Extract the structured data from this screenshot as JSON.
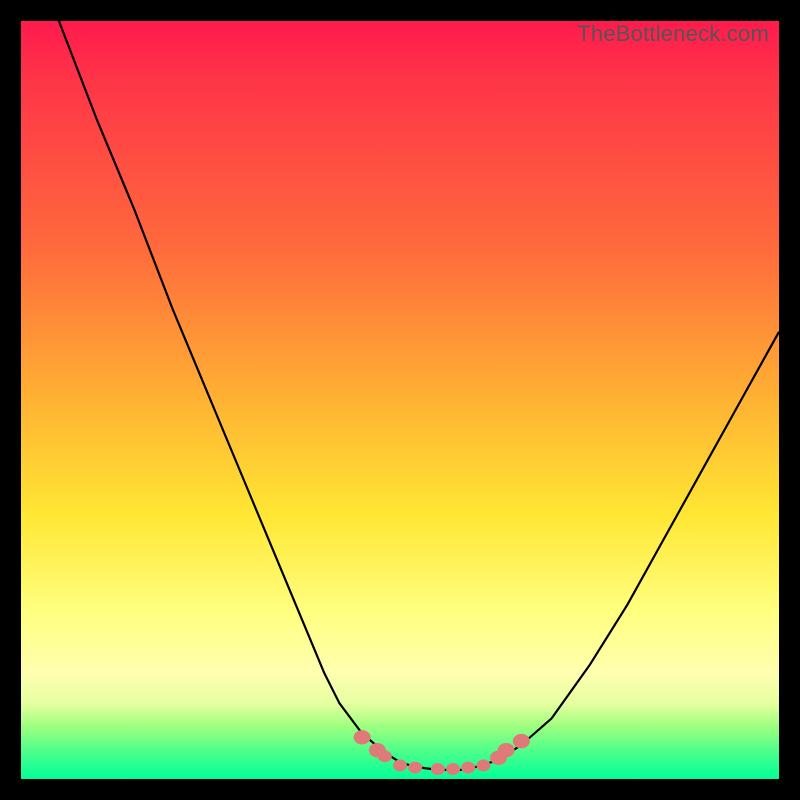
{
  "watermark": "TheBottleneck.com",
  "colors": {
    "background": "#000000",
    "gradient_top": "#ff1a4d",
    "gradient_mid_upper": "#ff6a3c",
    "gradient_mid": "#ffe633",
    "gradient_mid_lower": "#ffffb0",
    "gradient_bottom": "#00ff99",
    "curve": "#000000",
    "markers": "#e07a78"
  },
  "chart_data": {
    "type": "line",
    "title": "",
    "xlabel": "",
    "ylabel": "",
    "xlim": [
      0,
      100
    ],
    "ylim": [
      0,
      100
    ],
    "x": [
      5,
      10,
      15,
      20,
      25,
      30,
      35,
      40,
      42,
      45,
      48,
      50,
      52,
      55,
      58,
      60,
      63,
      66,
      70,
      75,
      80,
      85,
      90,
      95,
      100
    ],
    "y": [
      100,
      87,
      75,
      62,
      50,
      38,
      26,
      14,
      10,
      6,
      3.5,
      2.2,
      1.6,
      1.2,
      1.2,
      1.6,
      2.5,
      4.5,
      8,
      15,
      23,
      32,
      41,
      50,
      59
    ],
    "markers_x": [
      45,
      47,
      48,
      50,
      52,
      55,
      57,
      59,
      61,
      63,
      64,
      66
    ],
    "markers_y": [
      5.5,
      3.8,
      3.0,
      1.8,
      1.5,
      1.3,
      1.3,
      1.5,
      1.8,
      2.8,
      3.8,
      5.0
    ],
    "gradient_stops": [
      {
        "pos": 0.0,
        "color": "#ff1a4d"
      },
      {
        "pos": 0.3,
        "color": "#ff6a3c"
      },
      {
        "pos": 0.55,
        "color": "#ffe633"
      },
      {
        "pos": 0.85,
        "color": "#ffffb0"
      },
      {
        "pos": 1.0,
        "color": "#00ff99"
      }
    ]
  }
}
